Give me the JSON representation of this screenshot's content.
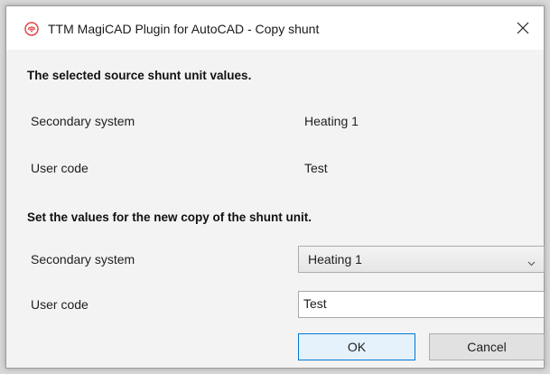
{
  "window": {
    "title": "TTM MagiCAD Plugin for AutoCAD - Copy shunt",
    "app_icon": "ttm-logo-icon",
    "close_icon": "close-icon",
    "accent_color": "#e0484a"
  },
  "source_section": {
    "heading": "The selected source shunt unit values.",
    "secondary_system": {
      "label": "Secondary system",
      "value": "Heating 1"
    },
    "user_code": {
      "label": "User code",
      "value": "Test"
    }
  },
  "copy_section": {
    "heading": "Set the values for the new copy of the shunt unit.",
    "secondary_system": {
      "label": "Secondary system",
      "selected": "Heating 1",
      "dropdown_icon": "chevron-down-icon"
    },
    "user_code": {
      "label": "User code",
      "value": "Test"
    }
  },
  "buttons": {
    "ok": "OK",
    "cancel": "Cancel"
  }
}
